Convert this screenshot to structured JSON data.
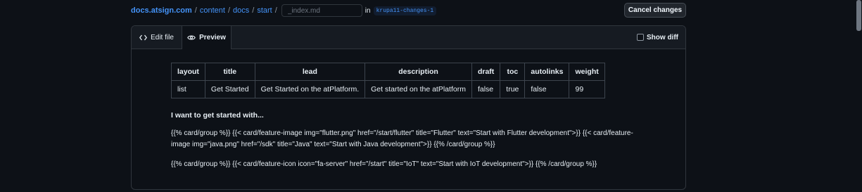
{
  "breadcrumb": {
    "repo": "docs.atsign.com",
    "path": [
      "content",
      "docs",
      "start"
    ],
    "separator": "/"
  },
  "filename": {
    "value": "",
    "placeholder": "_index.md"
  },
  "in_label": "in",
  "branch": "krupa11-changes-1",
  "cancel_label": "Cancel changes",
  "tabs": {
    "edit": "Edit file",
    "preview": "Preview"
  },
  "show_diff_label": "Show diff",
  "frontmatter": {
    "headers": [
      "layout",
      "title",
      "lead",
      "description",
      "draft",
      "toc",
      "autolinks",
      "weight"
    ],
    "row": [
      "list",
      "Get Started",
      "Get Started on the atPlatform.",
      "Get started on the atPlatform",
      "false",
      "true",
      "false",
      "99"
    ]
  },
  "heading": "I want to get started with...",
  "paragraphs": [
    "{{% card/group %}} {{< card/feature-image img=\"flutter.png\" href=\"/start/flutter\" title=\"Flutter\" text=\"Start with Flutter development\">}} {{< card/feature-image img=\"java.png\" href=\"/sdk\" title=\"Java\" text=\"Start with Java development\">}} {{% /card/group %}}",
    "{{% card/group %}} {{< card/feature-icon icon=\"fa-server\" href=\"/start\" title=\"IoT\" text=\"Start with IoT development\">}} {{% /card/group %}}"
  ],
  "colors": {
    "accent": "#4493f8",
    "background": "#0d1117",
    "border": "#30363d"
  }
}
